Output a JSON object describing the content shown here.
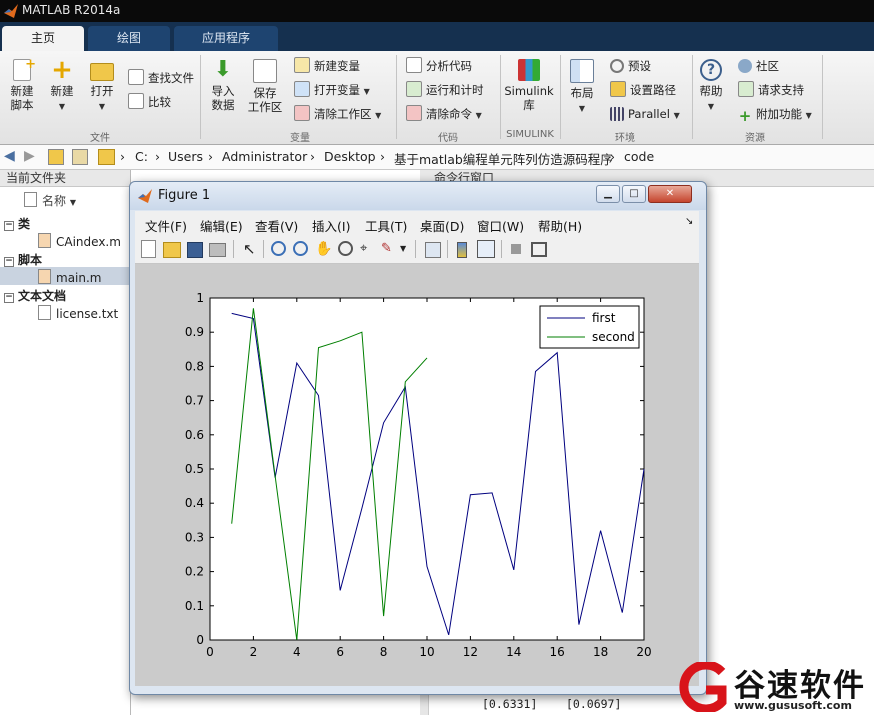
{
  "app": {
    "title": "MATLAB R2014a"
  },
  "ribbon_tabs": [
    {
      "label": "主页",
      "active": true
    },
    {
      "label": "绘图",
      "active": false
    },
    {
      "label": "应用程序",
      "active": false
    }
  ],
  "ribbon": {
    "new_script": {
      "line1": "新建",
      "line2": "脚本"
    },
    "new": "新建",
    "open": "打开",
    "find_files": "查找文件",
    "compare": "比较",
    "import": {
      "line1": "导入",
      "line2": "数据"
    },
    "save_ws": {
      "line1": "保存",
      "line2": "工作区"
    },
    "new_var": "新建变量",
    "open_var": "打开变量",
    "clear_ws": "清除工作区",
    "analyze": "分析代码",
    "run_time": "运行和计时",
    "clear_cmd": "清除命令",
    "simulink": {
      "line1": "Simulink",
      "line2": "库"
    },
    "layout": "布局",
    "prefs": "预设",
    "set_path": "设置路径",
    "parallel": "Parallel",
    "help": "帮助",
    "community": "社区",
    "request": "请求支持",
    "addons": "附加功能",
    "groups": {
      "file": "文件",
      "variable": "变量",
      "code": "代码",
      "simulink": "SIMULINK",
      "env": "环境",
      "resources": "资源"
    }
  },
  "address": {
    "crumbs": [
      "C:",
      "Users",
      "Administrator",
      "Desktop",
      "基于matlab编程单元阵列仿造源码程序",
      "code"
    ]
  },
  "current_folder": {
    "title": "当前文件夹",
    "column": "名称",
    "groups": [
      {
        "label": "类",
        "files": [
          "CAindex.m"
        ]
      },
      {
        "label": "脚本",
        "files": [
          "main.m"
        ]
      },
      {
        "label": "文本文档",
        "files": [
          "license.txt"
        ]
      }
    ]
  },
  "command_window": {
    "title": "命令行窗口",
    "values": [
      "[0.6331]",
      "[0.0697]"
    ]
  },
  "figure": {
    "title": "Figure 1",
    "menus": [
      "文件(F)",
      "编辑(E)",
      "查看(V)",
      "插入(I)",
      "工具(T)",
      "桌面(D)",
      "窗口(W)",
      "帮助(H)"
    ]
  },
  "chart_data": {
    "type": "line",
    "xlim": [
      0,
      20
    ],
    "ylim": [
      0,
      1
    ],
    "xticks": [
      0,
      2,
      4,
      6,
      8,
      10,
      12,
      14,
      16,
      18,
      20
    ],
    "yticks": [
      0,
      0.1,
      0.2,
      0.3,
      0.4,
      0.5,
      0.6,
      0.7,
      0.8,
      0.9,
      1
    ],
    "legend_position": "top-right",
    "grid": false,
    "series": [
      {
        "name": "first",
        "color": "#00007f",
        "x": [
          1,
          2,
          3,
          4,
          5,
          6,
          7,
          8,
          9,
          10,
          11,
          12,
          13,
          14,
          15,
          16,
          17,
          18,
          19,
          20
        ],
        "y": [
          0.955,
          0.94,
          0.475,
          0.81,
          0.715,
          0.145,
          0.385,
          0.635,
          0.74,
          0.215,
          0.015,
          0.425,
          0.43,
          0.205,
          0.785,
          0.84,
          0.045,
          0.32,
          0.08,
          0.5
        ]
      },
      {
        "name": "second",
        "color": "#007f00",
        "x": [
          1,
          2,
          3,
          4,
          5,
          6,
          7,
          8,
          9,
          10
        ],
        "y": [
          0.34,
          0.97,
          0.48,
          0.0,
          0.855,
          0.875,
          0.9,
          0.07,
          0.755,
          0.825
        ]
      }
    ]
  },
  "watermark": {
    "brand": "谷速软件",
    "url": "www.gususoft.com"
  }
}
